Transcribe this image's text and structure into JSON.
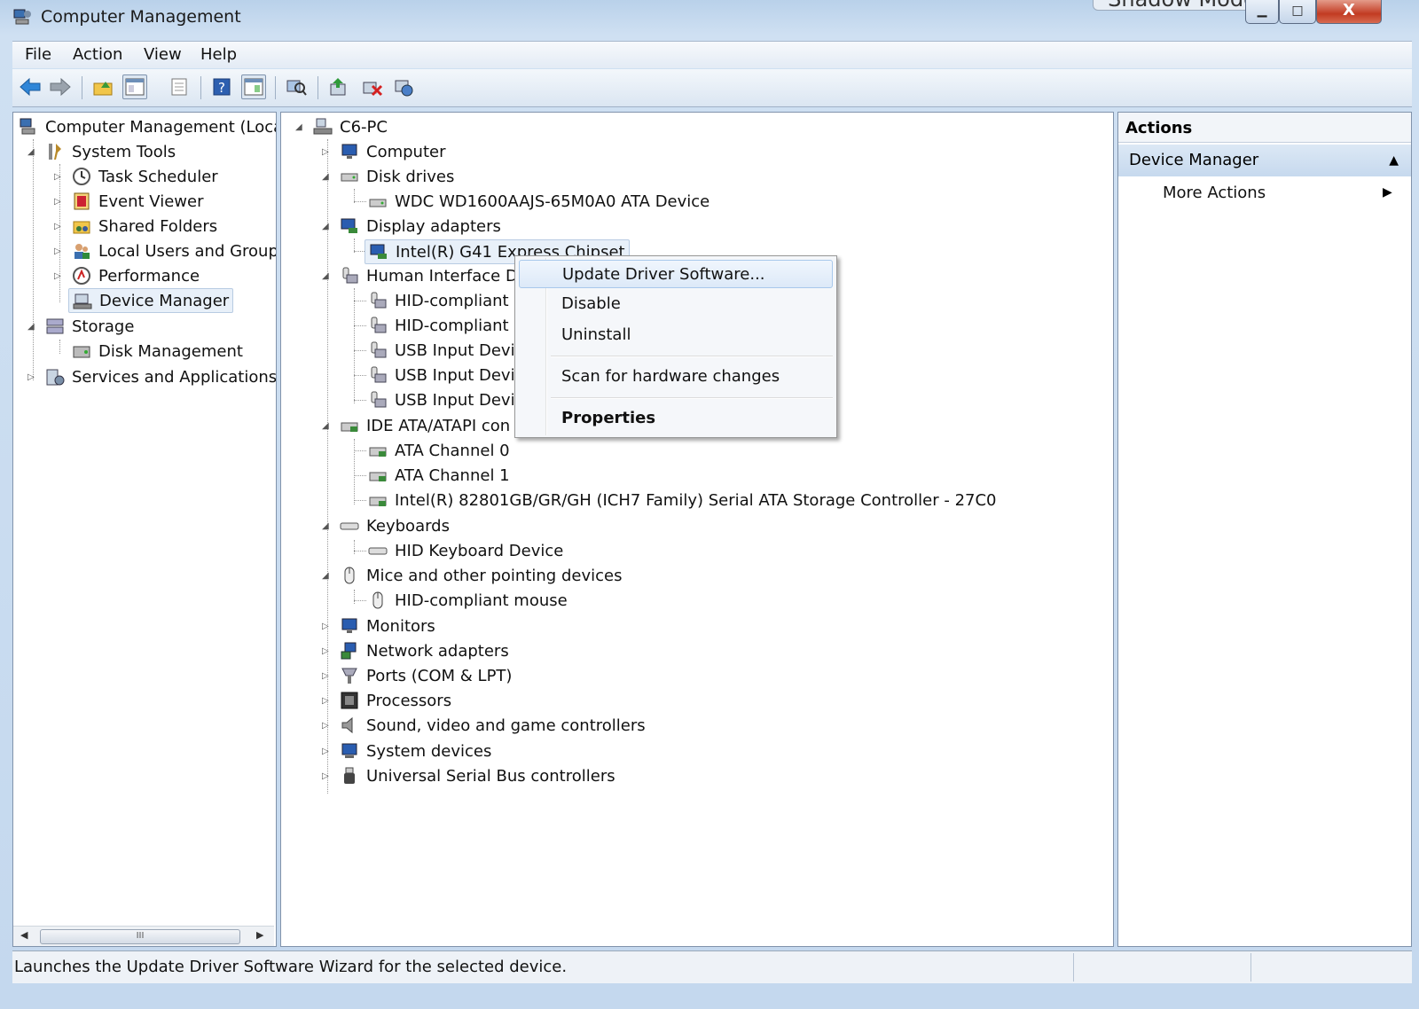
{
  "window": {
    "title": "Computer Management",
    "overlay_label": "Shadow Mode",
    "controls": {
      "minimize": "▁",
      "maximize": "□",
      "close": "X"
    }
  },
  "menubar": [
    "File",
    "Action",
    "View",
    "Help"
  ],
  "left_tree": {
    "root": "Computer Management (Local",
    "system_tools": "System Tools",
    "task_scheduler": "Task Scheduler",
    "event_viewer": "Event Viewer",
    "shared_folders": "Shared Folders",
    "local_users": "Local Users and Groups",
    "performance": "Performance",
    "device_manager": "Device Manager",
    "storage": "Storage",
    "disk_management": "Disk Management",
    "services": "Services and Applications",
    "scroll_thumb": "III"
  },
  "device_tree": {
    "root": "C6-PC",
    "computer": "Computer",
    "disk_drives": "Disk drives",
    "wdc": "WDC WD1600AAJS-65M0A0 ATA Device",
    "display_adapters": "Display adapters",
    "intel_g41": "Intel(R) G41 Express Chipset",
    "hid": "Human Interface De",
    "hid1": "HID-compliant c",
    "hid2": "HID-compliant c",
    "usb1": "USB Input Devic",
    "usb2": "USB Input Devic",
    "usb3": "USB Input Devic",
    "ide": "IDE ATA/ATAPI con",
    "ata0": "ATA Channel 0",
    "ata1": "ATA Channel 1",
    "sata": "Intel(R) 82801GB/GR/GH (ICH7 Family) Serial ATA Storage Controller - 27C0",
    "keyboards": "Keyboards",
    "hid_kb": "HID Keyboard Device",
    "mice": "Mice and other pointing devices",
    "hid_mouse": "HID-compliant mouse",
    "monitors": "Monitors",
    "network": "Network adapters",
    "ports": "Ports (COM & LPT)",
    "processors": "Processors",
    "sound": "Sound, video and game controllers",
    "system_devices": "System devices",
    "usb_controllers": "Universal Serial Bus controllers"
  },
  "context_menu": {
    "update": "Update Driver Software...",
    "disable": "Disable",
    "uninstall": "Uninstall",
    "scan": "Scan for hardware changes",
    "properties": "Properties"
  },
  "actions_pane": {
    "header": "Actions",
    "section": "Device Manager",
    "more": "More Actions"
  },
  "status": "Launches the Update Driver Software Wizard for the selected device."
}
